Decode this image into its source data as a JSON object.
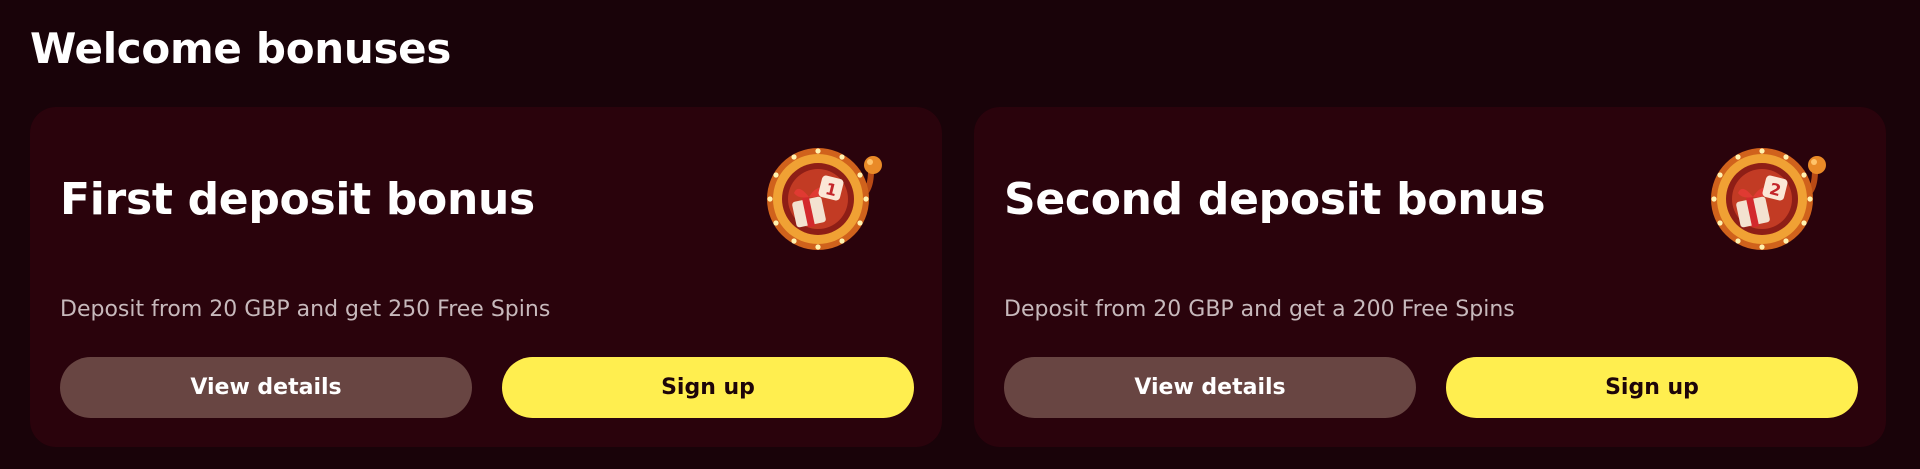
{
  "section": {
    "title": "Welcome bonuses"
  },
  "cards": [
    {
      "title": "First deposit bonus",
      "description": "Deposit from 20 GBP and get 250 Free Spins",
      "details_label": "View details",
      "signup_label": "Sign up",
      "badge_number": "1",
      "icon": "slot-machine-gift-icon"
    },
    {
      "title": "Second deposit bonus",
      "description": "Deposit from 20 GBP and get a 200 Free Spins",
      "details_label": "View details",
      "signup_label": "Sign up",
      "badge_number": "2",
      "icon": "slot-machine-gift-icon"
    }
  ],
  "colors": {
    "background": "#190309",
    "card": "#2a030c",
    "details_button": "#684542",
    "signup_button": "#ffee4f"
  }
}
